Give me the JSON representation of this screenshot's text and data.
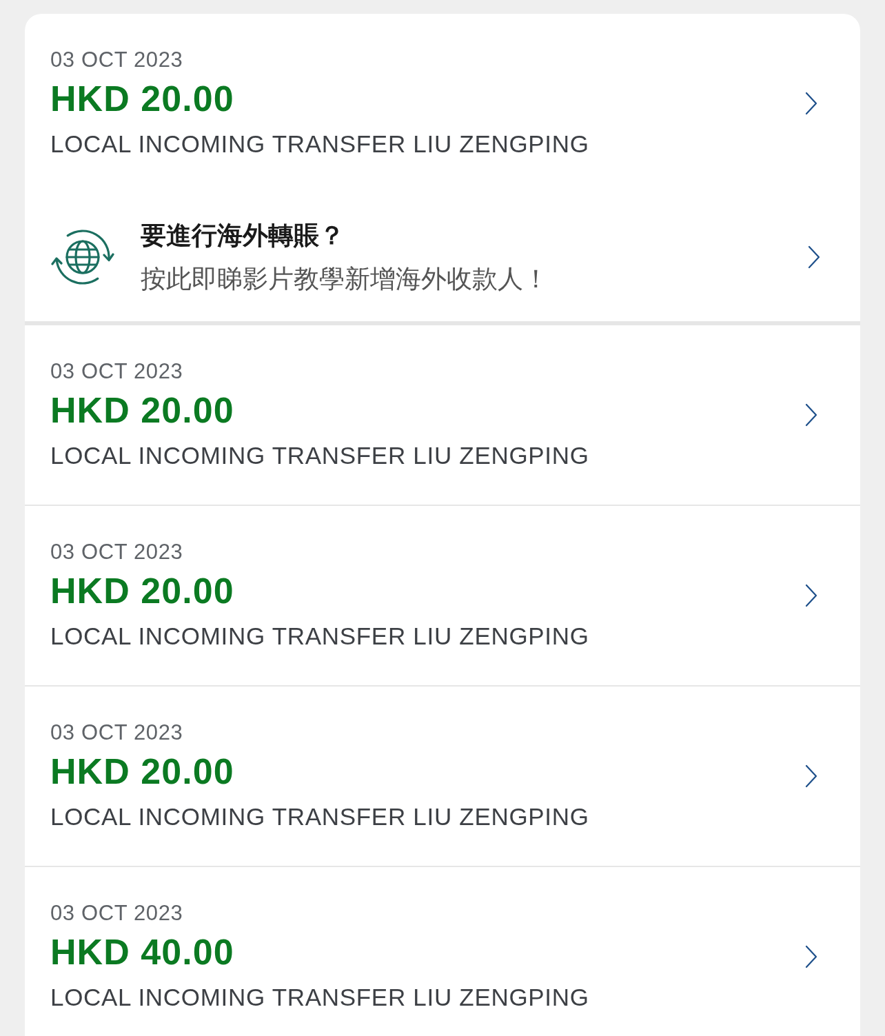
{
  "items": [
    {
      "kind": "transaction",
      "date": "03 OCT 2023",
      "amount": "HKD 20.00",
      "description": "LOCAL INCOMING TRANSFER LIU ZENGPING"
    },
    {
      "kind": "promo",
      "title": "要進行海外轉賬？",
      "subtitle": "按此即睇影片教學新增海外收款人！"
    },
    {
      "kind": "transaction",
      "date": "03 OCT 2023",
      "amount": "HKD 20.00",
      "description": "LOCAL INCOMING TRANSFER LIU ZENGPING"
    },
    {
      "kind": "transaction",
      "date": "03 OCT 2023",
      "amount": "HKD 20.00",
      "description": "LOCAL INCOMING TRANSFER LIU ZENGPING"
    },
    {
      "kind": "transaction",
      "date": "03 OCT 2023",
      "amount": "HKD 20.00",
      "description": "LOCAL INCOMING TRANSFER LIU ZENGPING"
    },
    {
      "kind": "transaction",
      "date": "03 OCT 2023",
      "amount": "HKD 40.00",
      "description": "LOCAL INCOMING TRANSFER LIU ZENGPING"
    }
  ]
}
